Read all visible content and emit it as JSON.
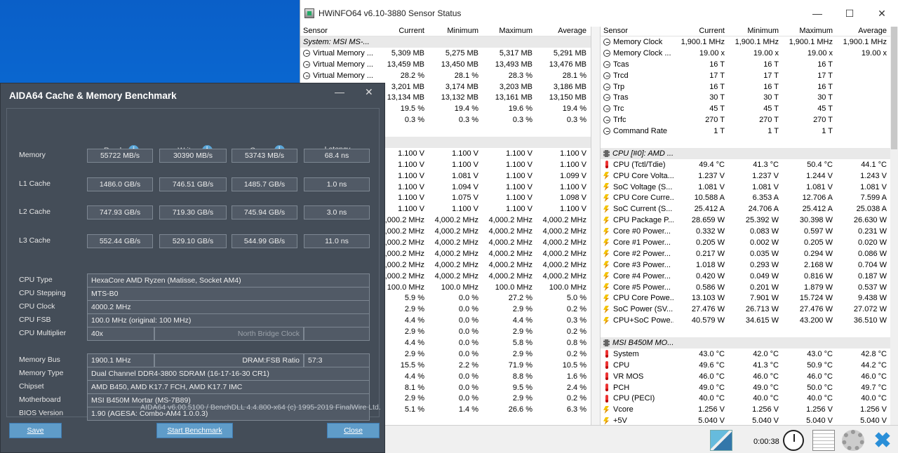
{
  "hwinfo": {
    "title": "HWiNFO64 v6.10-3880 Sensor Status",
    "columns": [
      "Sensor",
      "Current",
      "Minimum",
      "Maximum",
      "Average"
    ],
    "left_rows": [
      {
        "type": "group",
        "name": "System: MSI MS-...",
        "cur": "",
        "min": "",
        "max": "",
        "avg": ""
      },
      {
        "icon": "clock",
        "name": "Virtual Memory ...",
        "cur": "5,309 MB",
        "min": "5,275 MB",
        "max": "5,317 MB",
        "avg": "5,291 MB"
      },
      {
        "icon": "clock",
        "name": "Virtual Memory ...",
        "cur": "13,459 MB",
        "min": "13,450 MB",
        "max": "13,493 MB",
        "avg": "13,476 MB"
      },
      {
        "icon": "clock",
        "name": "Virtual Memory ...",
        "cur": "28.2 %",
        "min": "28.1 %",
        "max": "28.3 %",
        "avg": "28.1 %"
      },
      {
        "icon": "none",
        "name": "",
        "cur": "3,201 MB",
        "min": "3,174 MB",
        "max": "3,203 MB",
        "avg": "3,186 MB"
      },
      {
        "icon": "none",
        "name": "",
        "cur": "13,134 MB",
        "min": "13,132 MB",
        "max": "13,161 MB",
        "avg": "13,150 MB"
      },
      {
        "icon": "none",
        "name": "",
        "cur": "19.5 %",
        "min": "19.4 %",
        "max": "19.6 %",
        "avg": "19.4 %"
      },
      {
        "icon": "none",
        "name": "",
        "cur": "0.3 %",
        "min": "0.3 %",
        "max": "0.3 %",
        "avg": "0.3 %"
      },
      {
        "type": "blank",
        "name": "",
        "cur": "",
        "min": "",
        "max": "",
        "avg": ""
      },
      {
        "type": "group",
        "name": "",
        "cur": "",
        "min": "",
        "max": "",
        "avg": ""
      },
      {
        "icon": "none",
        "name": "",
        "cur": "1.100 V",
        "min": "1.100 V",
        "max": "1.100 V",
        "avg": "1.100 V"
      },
      {
        "icon": "none",
        "name": "",
        "cur": "1.100 V",
        "min": "1.100 V",
        "max": "1.100 V",
        "avg": "1.100 V"
      },
      {
        "icon": "none",
        "name": "",
        "cur": "1.100 V",
        "min": "1.081 V",
        "max": "1.100 V",
        "avg": "1.099 V"
      },
      {
        "icon": "none",
        "name": "",
        "cur": "1.100 V",
        "min": "1.094 V",
        "max": "1.100 V",
        "avg": "1.100 V"
      },
      {
        "icon": "none",
        "name": "",
        "cur": "1.100 V",
        "min": "1.075 V",
        "max": "1.100 V",
        "avg": "1.098 V"
      },
      {
        "icon": "none",
        "name": "",
        "cur": "1.100 V",
        "min": "1.100 V",
        "max": "1.100 V",
        "avg": "1.100 V"
      },
      {
        "icon": "none",
        "name": "",
        "cur": "4,000.2 MHz",
        "min": "4,000.2 MHz",
        "max": "4,000.2 MHz",
        "avg": "4,000.2 MHz"
      },
      {
        "icon": "none",
        "name": "",
        "cur": "4,000.2 MHz",
        "min": "4,000.2 MHz",
        "max": "4,000.2 MHz",
        "avg": "4,000.2 MHz"
      },
      {
        "icon": "none",
        "name": "",
        "cur": "4,000.2 MHz",
        "min": "4,000.2 MHz",
        "max": "4,000.2 MHz",
        "avg": "4,000.2 MHz"
      },
      {
        "icon": "none",
        "name": "",
        "cur": "4,000.2 MHz",
        "min": "4,000.2 MHz",
        "max": "4,000.2 MHz",
        "avg": "4,000.2 MHz"
      },
      {
        "icon": "none",
        "name": "",
        "cur": "4,000.2 MHz",
        "min": "4,000.2 MHz",
        "max": "4,000.2 MHz",
        "avg": "4,000.2 MHz"
      },
      {
        "icon": "none",
        "name": "",
        "cur": "4,000.2 MHz",
        "min": "4,000.2 MHz",
        "max": "4,000.2 MHz",
        "avg": "4,000.2 MHz"
      },
      {
        "icon": "none",
        "name": "",
        "cur": "100.0 MHz",
        "min": "100.0 MHz",
        "max": "100.0 MHz",
        "avg": "100.0 MHz"
      },
      {
        "icon": "none",
        "name": "",
        "cur": "5.9 %",
        "min": "0.0 %",
        "max": "27.2 %",
        "avg": "5.0 %"
      },
      {
        "icon": "none",
        "name": "",
        "cur": "2.9 %",
        "min": "0.0 %",
        "max": "2.9 %",
        "avg": "0.2 %"
      },
      {
        "icon": "none",
        "name": "",
        "cur": "4.4 %",
        "min": "0.0 %",
        "max": "4.4 %",
        "avg": "0.3 %"
      },
      {
        "icon": "none",
        "name": "",
        "cur": "2.9 %",
        "min": "0.0 %",
        "max": "2.9 %",
        "avg": "0.2 %"
      },
      {
        "icon": "none",
        "name": "",
        "cur": "4.4 %",
        "min": "0.0 %",
        "max": "5.8 %",
        "avg": "0.8 %"
      },
      {
        "icon": "none",
        "name": "",
        "cur": "2.9 %",
        "min": "0.0 %",
        "max": "2.9 %",
        "avg": "0.2 %"
      },
      {
        "icon": "none",
        "name": "",
        "cur": "15.5 %",
        "min": "2.2 %",
        "max": "71.9 %",
        "avg": "10.5 %"
      },
      {
        "icon": "none",
        "name": "",
        "cur": "4.4 %",
        "min": "0.0 %",
        "max": "8.8 %",
        "avg": "1.6 %"
      },
      {
        "icon": "none",
        "name": "",
        "cur": "8.1 %",
        "min": "0.0 %",
        "max": "9.5 %",
        "avg": "2.4 %"
      },
      {
        "icon": "none",
        "name": "",
        "cur": "2.9 %",
        "min": "0.0 %",
        "max": "2.9 %",
        "avg": "0.2 %"
      },
      {
        "icon": "none",
        "name": "",
        "cur": "5.1 %",
        "min": "1.4 %",
        "max": "26.6 %",
        "avg": "6.3 %"
      }
    ],
    "right_rows": [
      {
        "icon": "clock",
        "name": "Memory Clock",
        "cur": "1,900.1 MHz",
        "min": "1,900.1 MHz",
        "max": "1,900.1 MHz",
        "avg": "1,900.1 MHz"
      },
      {
        "icon": "clock",
        "name": "Memory Clock ...",
        "cur": "19.00 x",
        "min": "19.00 x",
        "max": "19.00 x",
        "avg": "19.00 x"
      },
      {
        "icon": "clock",
        "name": "Tcas",
        "cur": "16 T",
        "min": "16 T",
        "max": "16 T",
        "avg": ""
      },
      {
        "icon": "clock",
        "name": "Trcd",
        "cur": "17 T",
        "min": "17 T",
        "max": "17 T",
        "avg": ""
      },
      {
        "icon": "clock",
        "name": "Trp",
        "cur": "16 T",
        "min": "16 T",
        "max": "16 T",
        "avg": ""
      },
      {
        "icon": "clock",
        "name": "Tras",
        "cur": "30 T",
        "min": "30 T",
        "max": "30 T",
        "avg": ""
      },
      {
        "icon": "clock",
        "name": "Trc",
        "cur": "45 T",
        "min": "45 T",
        "max": "45 T",
        "avg": ""
      },
      {
        "icon": "clock",
        "name": "Trfc",
        "cur": "270 T",
        "min": "270 T",
        "max": "270 T",
        "avg": ""
      },
      {
        "icon": "clock",
        "name": "Command Rate",
        "cur": "1 T",
        "min": "1 T",
        "max": "1 T",
        "avg": ""
      },
      {
        "type": "blank",
        "name": "",
        "cur": "",
        "min": "",
        "max": "",
        "avg": ""
      },
      {
        "type": "group",
        "icon": "chip",
        "name": "CPU [#0]: AMD ...",
        "cur": "",
        "min": "",
        "max": "",
        "avg": ""
      },
      {
        "icon": "therm",
        "name": "CPU (Tctl/Tdie)",
        "cur": "49.4 °C",
        "min": "41.3 °C",
        "max": "50.4 °C",
        "avg": "44.1 °C"
      },
      {
        "icon": "bolt",
        "name": "CPU Core Volta...",
        "cur": "1.237 V",
        "min": "1.237 V",
        "max": "1.244 V",
        "avg": "1.243 V"
      },
      {
        "icon": "bolt",
        "name": "SoC Voltage (S...",
        "cur": "1.081 V",
        "min": "1.081 V",
        "max": "1.081 V",
        "avg": "1.081 V"
      },
      {
        "icon": "bolt",
        "name": "CPU Core Curre...",
        "cur": "10.588 A",
        "min": "6.353 A",
        "max": "12.706 A",
        "avg": "7.599 A"
      },
      {
        "icon": "bolt",
        "name": "SoC Current (S...",
        "cur": "25.412 A",
        "min": "24.706 A",
        "max": "25.412 A",
        "avg": "25.038 A"
      },
      {
        "icon": "bolt",
        "name": "CPU Package P...",
        "cur": "28.659 W",
        "min": "25.392 W",
        "max": "30.398 W",
        "avg": "26.630 W"
      },
      {
        "icon": "bolt",
        "name": "Core #0 Power...",
        "cur": "0.332 W",
        "min": "0.083 W",
        "max": "0.597 W",
        "avg": "0.231 W"
      },
      {
        "icon": "bolt",
        "name": "Core #1 Power...",
        "cur": "0.205 W",
        "min": "0.002 W",
        "max": "0.205 W",
        "avg": "0.020 W"
      },
      {
        "icon": "bolt",
        "name": "Core #2 Power...",
        "cur": "0.217 W",
        "min": "0.035 W",
        "max": "0.294 W",
        "avg": "0.086 W"
      },
      {
        "icon": "bolt",
        "name": "Core #3 Power...",
        "cur": "1.018 W",
        "min": "0.293 W",
        "max": "2.168 W",
        "avg": "0.704 W"
      },
      {
        "icon": "bolt",
        "name": "Core #4 Power...",
        "cur": "0.420 W",
        "min": "0.049 W",
        "max": "0.816 W",
        "avg": "0.187 W"
      },
      {
        "icon": "bolt",
        "name": "Core #5 Power...",
        "cur": "0.586 W",
        "min": "0.201 W",
        "max": "1.879 W",
        "avg": "0.537 W"
      },
      {
        "icon": "bolt",
        "name": "CPU Core Powe...",
        "cur": "13.103 W",
        "min": "7.901 W",
        "max": "15.724 W",
        "avg": "9.438 W"
      },
      {
        "icon": "bolt",
        "name": "SoC Power (SV...",
        "cur": "27.476 W",
        "min": "26.713 W",
        "max": "27.476 W",
        "avg": "27.072 W"
      },
      {
        "icon": "bolt",
        "name": "CPU+SoC Powe...",
        "cur": "40.579 W",
        "min": "34.615 W",
        "max": "43.200 W",
        "avg": "36.510 W"
      },
      {
        "type": "blank",
        "name": "",
        "cur": "",
        "min": "",
        "max": "",
        "avg": ""
      },
      {
        "type": "group",
        "icon": "chip",
        "name": "MSI B450M MO...",
        "cur": "",
        "min": "",
        "max": "",
        "avg": ""
      },
      {
        "icon": "therm",
        "name": "System",
        "cur": "43.0 °C",
        "min": "42.0 °C",
        "max": "43.0 °C",
        "avg": "42.8 °C"
      },
      {
        "icon": "therm",
        "name": "CPU",
        "cur": "49.6 °C",
        "min": "41.3 °C",
        "max": "50.9 °C",
        "avg": "44.2 °C"
      },
      {
        "icon": "therm",
        "name": "VR MOS",
        "cur": "46.0 °C",
        "min": "46.0 °C",
        "max": "46.0 °C",
        "avg": "46.0 °C"
      },
      {
        "icon": "therm",
        "name": "PCH",
        "cur": "49.0 °C",
        "min": "49.0 °C",
        "max": "50.0 °C",
        "avg": "49.7 °C"
      },
      {
        "icon": "therm",
        "name": "CPU (PECI)",
        "cur": "40.0 °C",
        "min": "40.0 °C",
        "max": "40.0 °C",
        "avg": "40.0 °C"
      },
      {
        "icon": "bolt",
        "name": "Vcore",
        "cur": "1.256 V",
        "min": "1.256 V",
        "max": "1.256 V",
        "avg": "1.256 V"
      },
      {
        "icon": "bolt",
        "name": "+5V",
        "cur": "5.040 V",
        "min": "5.040 V",
        "max": "5.040 V",
        "avg": "5.040 V"
      }
    ],
    "elapsed": "0:00:38"
  },
  "aida": {
    "title": "AIDA64 Cache & Memory Benchmark",
    "col_read": "Read",
    "col_write": "Write",
    "col_copy": "Copy",
    "col_latency": "Latency",
    "info": "i",
    "bench": [
      {
        "label": "Memory",
        "read": "55722 MB/s",
        "write": "30390 MB/s",
        "copy": "53743 MB/s",
        "latency": "68.4 ns"
      },
      {
        "label": "L1 Cache",
        "read": "1486.0 GB/s",
        "write": "746.51 GB/s",
        "copy": "1485.7 GB/s",
        "latency": "1.0 ns"
      },
      {
        "label": "L2 Cache",
        "read": "747.93 GB/s",
        "write": "719.30 GB/s",
        "copy": "745.94 GB/s",
        "latency": "3.0 ns"
      },
      {
        "label": "L3 Cache",
        "read": "552.44 GB/s",
        "write": "529.10 GB/s",
        "copy": "544.99 GB/s",
        "latency": "11.0 ns"
      }
    ],
    "cpu_type_label": "CPU Type",
    "cpu_type": "HexaCore AMD Ryzen  (Matisse, Socket AM4)",
    "cpu_stepping_label": "CPU Stepping",
    "cpu_stepping": "MTS-B0",
    "cpu_clock_label": "CPU Clock",
    "cpu_clock": "4000.2 MHz",
    "cpu_fsb_label": "CPU FSB",
    "cpu_fsb": "100.0 MHz  (original: 100 MHz)",
    "cpu_mult_label": "CPU Multiplier",
    "cpu_mult": "40x",
    "nb_clock_label": "North Bridge Clock",
    "nb_clock": "",
    "mem_bus_label": "Memory Bus",
    "mem_bus": "1900.1 MHz",
    "dram_fsb_label": "DRAM:FSB Ratio",
    "dram_fsb": "57:3",
    "mem_type_label": "Memory Type",
    "mem_type": "Dual Channel DDR4-3800 SDRAM  (16-17-16-30 CR1)",
    "chipset_label": "Chipset",
    "chipset": "AMD B450, AMD K17.7 FCH, AMD K17.7 IMC",
    "motherboard_label": "Motherboard",
    "motherboard": "MSI B450M Mortar (MS-7B89)",
    "bios_label": "BIOS Version",
    "bios": "1.90  (AGESA: Combo-AM4 1.0.0.3)",
    "footer": "AIDA64 v6.00.5100 / BenchDLL 4.4.800-x64  (c) 1995-2019 FinalWire Ltd.",
    "save": "Save",
    "start": "Start Benchmark",
    "close": "Close"
  }
}
